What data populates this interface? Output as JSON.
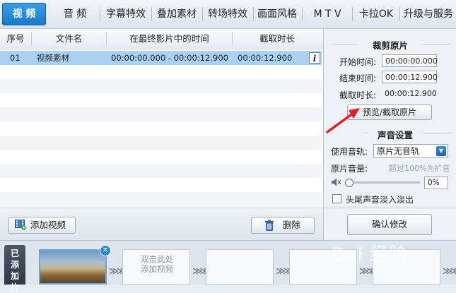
{
  "tabs": [
    {
      "label": "视 频",
      "active": true
    },
    {
      "label": "音 频"
    },
    {
      "label": "字幕特效"
    },
    {
      "label": "叠加素材"
    },
    {
      "label": "转场特效"
    },
    {
      "label": "画面风格"
    },
    {
      "label": "M T V"
    },
    {
      "label": "卡拉OK"
    },
    {
      "label": "升级与服务"
    }
  ],
  "list": {
    "headers": [
      "序号",
      "文件名",
      "在最终影片中的时间",
      "截取时长"
    ],
    "rows": [
      {
        "index": "01",
        "name": "视频素材",
        "time": "00:00:00.000 - 00:00:12.900",
        "duration": "00:00:12.900",
        "info_icon": "i"
      }
    ]
  },
  "buttons": {
    "add_video": "添加视频",
    "delete": "删除",
    "preview_trim": "预览/截取原片",
    "confirm": "确认修改"
  },
  "trim": {
    "title": "裁剪原片",
    "start_label": "开始时间:",
    "start_value": "00:00:00.000",
    "end_label": "结束时间:",
    "end_value": "00:00:12.900",
    "duration_label": "截取时长:",
    "duration_value": "00:00:12.900"
  },
  "sound": {
    "title": "声音设置",
    "track_label": "使用音轨:",
    "track_value": "原片无音轨",
    "volume_label": "原片音量:",
    "volume_hint": "超过100%为扩音",
    "volume_value": "0%",
    "volume_level": 0,
    "fade_label": "头尾声音淡入淡出",
    "fade_checked": false
  },
  "timeline": {
    "added_label": "已添加片",
    "empty_slot_text": "双击此处添加视频",
    "arrow_glyph": "≫≫"
  },
  "icons": {
    "add_video": "film-add-icon",
    "delete": "trash-icon",
    "speaker": "speaker-mute-icon",
    "close": "close-icon",
    "dropdown": "chevron-down-icon"
  },
  "colors": {
    "active_tab": "#1e86d6",
    "selected_row": "#a9d0f5",
    "annotation_arrow": "#e02020"
  },
  "watermark": "Bai 经验"
}
